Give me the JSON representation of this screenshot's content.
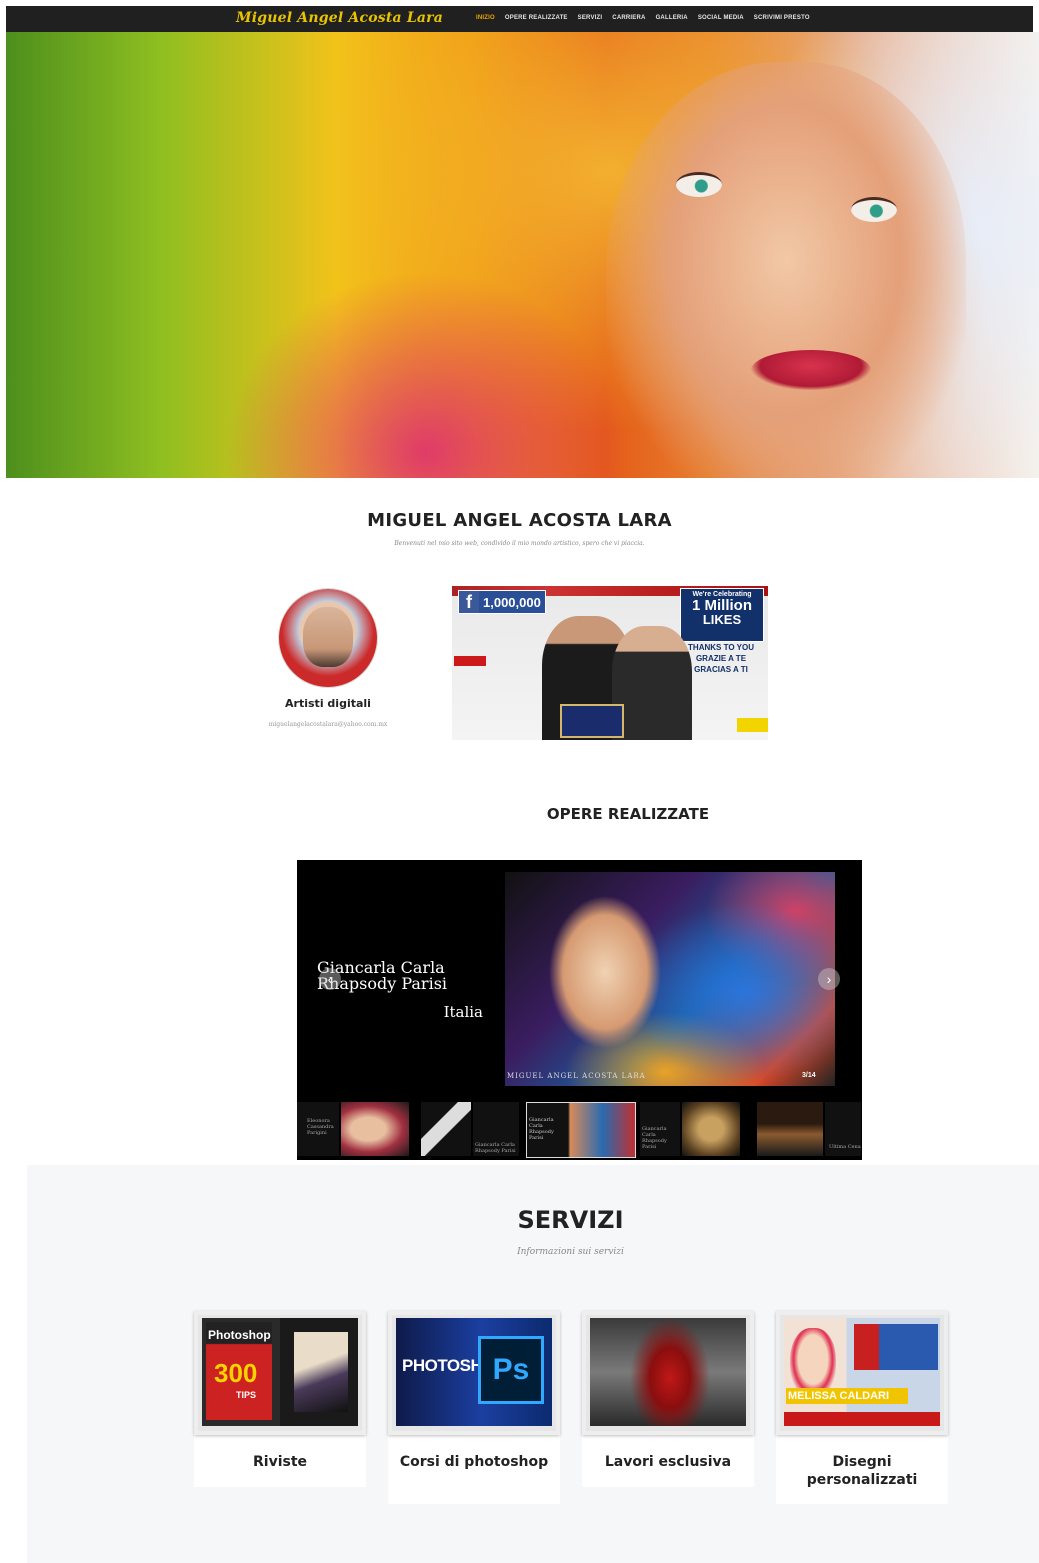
{
  "brand": "Miguel Angel Acosta Lara",
  "nav": {
    "items": [
      {
        "label": "INIZIO",
        "active": true
      },
      {
        "label": "OPERE REALIZZATE",
        "active": false
      },
      {
        "label": "SERVIZI",
        "active": false
      },
      {
        "label": "CARRIERA",
        "active": false
      },
      {
        "label": "GALLERIA",
        "active": false
      },
      {
        "label": "SOCIAL MEDIA",
        "active": false
      },
      {
        "label": "SCRIVIMI PRESTO",
        "active": false
      }
    ]
  },
  "colors": {
    "nav_bg": "#202020",
    "brand": "#e8c400",
    "nav_active": "#f0a500",
    "section_bg": "#f6f7f9"
  },
  "welcome": {
    "title": "MIGUEL ANGEL ACOSTA LARA",
    "subtitle": "Benvenuti nel mio sito web, condivido il mio mondo artistico, spero che vi piaccia."
  },
  "profile": {
    "role": "Artisti digitali",
    "email": "miguelangelacostalara@yahoo.com.mx"
  },
  "event_photo": {
    "fb_count": "1,000,000",
    "celebrate_small": "We're Celebrating",
    "celebrate_big": "1 Million",
    "celebrate_likes": "LIKES",
    "thanks_lines": [
      "THANKS TO YOU",
      "GRAZIE A TE",
      "GRACIAS A TI"
    ]
  },
  "opere": {
    "title": "OPERE REALIZZATE",
    "slide": {
      "name_line1": "Giancarla Carla",
      "name_line2": "Rhapsody Parisi",
      "country": "Italia",
      "image_label": "MIGUEL ANGEL ACOSTA LARA",
      "counter": "3/14"
    },
    "thumbs": [
      {
        "caption": "Eleonora Cassandra Parigini"
      },
      {
        "caption": ""
      },
      {
        "caption": "Giancarla Carla Rhapsody Parisi"
      },
      {
        "caption": "Giancarla Carla Rhapsody Parisi"
      },
      {
        "caption": "Giancarla Carla Rhapsody Parisi"
      },
      {
        "caption": ""
      },
      {
        "caption": ""
      },
      {
        "caption": "Ultima Cena"
      }
    ]
  },
  "servizi": {
    "title": "SERVIZI",
    "subtitle": "Informazioni sui servizi",
    "cards": [
      {
        "label": "Riviste"
      },
      {
        "label": "Corsi di photoshop"
      },
      {
        "label": "Lavori esclusiva"
      },
      {
        "label": "Disegni personalizzati"
      }
    ],
    "card_texts": {
      "photoshop_word": "PHOTOSHOP",
      "ps_badge": "Ps",
      "mag_title": "Photoshop",
      "mag_number": "300",
      "mag_tips": "TIPS",
      "melissa": "MELISSA CALDARI"
    }
  }
}
